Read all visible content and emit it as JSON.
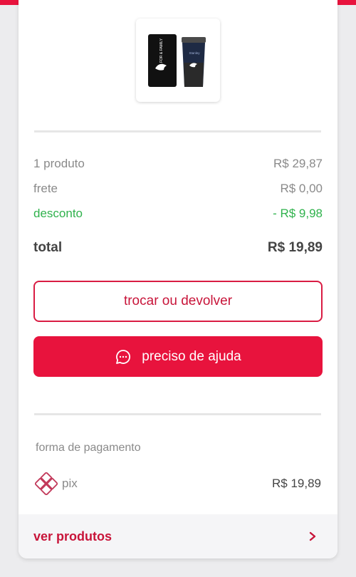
{
  "summary": {
    "items_label": "1 produto",
    "items_value": "R$ 29,87",
    "shipping_label": "frete",
    "shipping_value": "R$ 0,00",
    "discount_label": "desconto",
    "discount_value": "- R$ 9,98",
    "total_label": "total",
    "total_value": "R$ 19,89"
  },
  "actions": {
    "return_label": "trocar ou devolver",
    "help_label": "preciso de ajuda"
  },
  "payment": {
    "section_label": "forma de pagamento",
    "method": "pix",
    "amount": "R$ 19,89"
  },
  "footer": {
    "products_label": "ver produtos"
  },
  "product_image": {
    "box_text": "FOR & FAMILY",
    "cup_text": "Stanley"
  },
  "colors": {
    "accent": "#e8133d",
    "discount": "#2fb24c",
    "pix": "#c2395a"
  }
}
